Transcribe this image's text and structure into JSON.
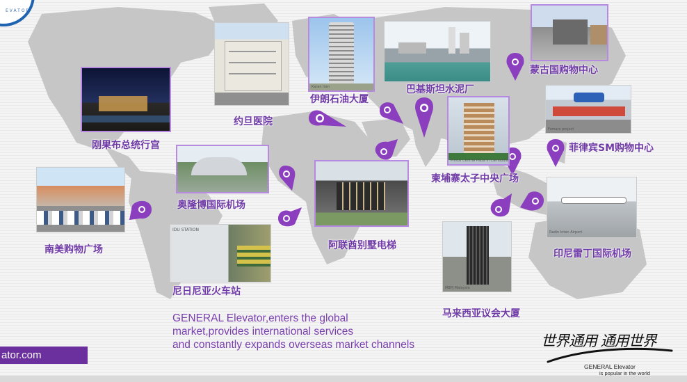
{
  "logo": {
    "text": "EVATOR"
  },
  "projects": [
    {
      "id": "jordan-hospital",
      "label": "约旦医院",
      "caption": ""
    },
    {
      "id": "iran-oil-tower",
      "label": "伊朗石油大厦",
      "caption": "Karan Iran"
    },
    {
      "id": "pakistan-cement",
      "label": "巴基斯坦水泥厂",
      "caption": ""
    },
    {
      "id": "mongolia-mall",
      "label": "蒙古国购物中心",
      "caption": ""
    },
    {
      "id": "philippines-sm-mall",
      "label": "菲律宾SM购物中心",
      "caption": "Fomars project"
    },
    {
      "id": "congo-palace",
      "label": "刚果布总统行宫",
      "caption": ""
    },
    {
      "id": "cambodia-central-plaza",
      "label": "柬埔寨太子中央广场",
      "caption": "Prince Central Plaza in Cambodia"
    },
    {
      "id": "abuja-airport",
      "label": "奥隆博国际机场",
      "caption": ""
    },
    {
      "id": "uae-villa",
      "label": "阿联酋别墅电梯",
      "caption": ""
    },
    {
      "id": "south-america-mall",
      "label": "南美购物广场",
      "caption": ""
    },
    {
      "id": "indonesia-airport",
      "label": "印尼雷丁国际机场",
      "caption": "Radin Inten Airport"
    },
    {
      "id": "malaysia-parliament",
      "label": "马来西亚议会大厦",
      "caption": "MBPJ Malaysia"
    },
    {
      "id": "nigeria-station",
      "label": "尼日尼亚火车站",
      "caption": "IDU STATION"
    }
  ],
  "tagline": {
    "line1": "GENERAL Elevator,enters the global",
    "line2": "market,provides international services",
    "line3": "and constantly expands overseas market channels"
  },
  "website": "ator.com",
  "slogan": {
    "cn": "世界通用 通用世界",
    "en1": "GENERAL Elevator",
    "en2": "is popular in the world"
  },
  "colors": {
    "accent": "#6f3aa6",
    "pin": "#8b3fbf",
    "map": "#c4c4c4",
    "bar": "#6b2f9e"
  },
  "icons": [
    "map-pin-icon",
    "world-map"
  ]
}
